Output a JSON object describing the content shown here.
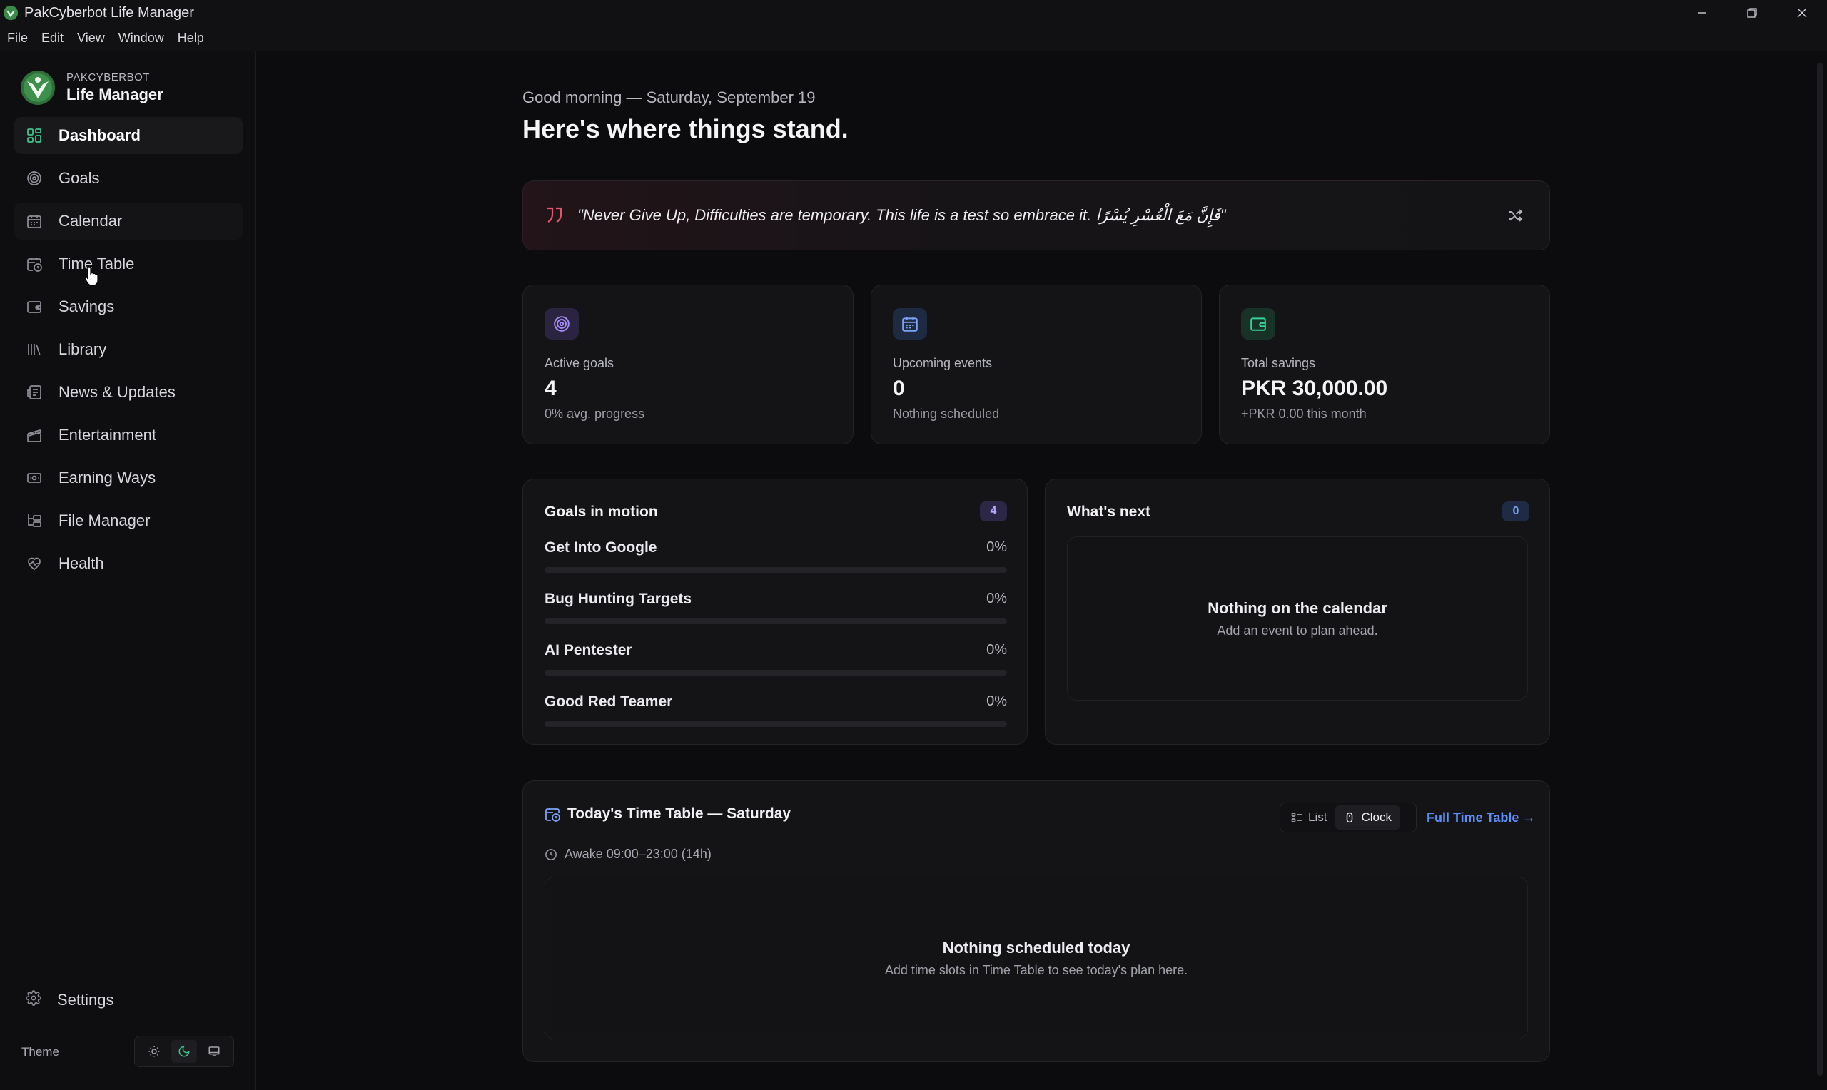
{
  "window": {
    "title": "PakCyberbot Life Manager"
  },
  "menu": [
    "File",
    "Edit",
    "View",
    "Window",
    "Help"
  ],
  "brand": {
    "small": "PAKCYBERBOT",
    "big": "Life Manager"
  },
  "sidebar": {
    "items": [
      {
        "label": "Dashboard",
        "icon": "grid-icon",
        "active": true
      },
      {
        "label": "Goals",
        "icon": "target-icon"
      },
      {
        "label": "Calendar",
        "icon": "calendar-icon",
        "hover": true
      },
      {
        "label": "Time Table",
        "icon": "calendar-clock-icon"
      },
      {
        "label": "Savings",
        "icon": "wallet-icon"
      },
      {
        "label": "Library",
        "icon": "library-icon"
      },
      {
        "label": "News & Updates",
        "icon": "newspaper-icon"
      },
      {
        "label": "Entertainment",
        "icon": "clapperboard-icon"
      },
      {
        "label": "Earning Ways",
        "icon": "banknote-icon"
      },
      {
        "label": "File Manager",
        "icon": "folder-tree-icon"
      },
      {
        "label": "Health",
        "icon": "heart-pulse-icon"
      }
    ],
    "settings_label": "Settings",
    "theme_label": "Theme",
    "theme_selected": "dark"
  },
  "main": {
    "greeting": "Good morning — Saturday, September 19",
    "headline": "Here's where things stand.",
    "quote": "\"Never Give Up, Difficulties are temporary. This life is a test so embrace it. فَإِنَّ مَعَ الْعُسْرِ يُسْرًا\""
  },
  "stats": [
    {
      "label": "Active goals",
      "value": "4",
      "sub": "0% avg. progress",
      "icon": "target-icon",
      "accent": "#a78bfa"
    },
    {
      "label": "Upcoming events",
      "value": "0",
      "sub": "Nothing scheduled",
      "icon": "calendar-icon",
      "accent": "#7aa2f7"
    },
    {
      "label": "Total savings",
      "value": "PKR 30,000.00",
      "sub": "+PKR 0.00 this month",
      "icon": "wallet-icon",
      "accent": "#34d399"
    }
  ],
  "goals_panel": {
    "title": "Goals in motion",
    "count": "4",
    "goals": [
      {
        "name": "Get Into Google",
        "pct_label": "0%",
        "progress": 0
      },
      {
        "name": "Bug Hunting Targets",
        "pct_label": "0%",
        "progress": 0
      },
      {
        "name": "AI Pentester",
        "pct_label": "0%",
        "progress": 0
      },
      {
        "name": "Good Red Teamer",
        "pct_label": "0%",
        "progress": 0
      }
    ]
  },
  "next_panel": {
    "title": "What's next",
    "count": "0",
    "empty_title": "Nothing on the calendar",
    "empty_sub": "Add an event to plan ahead."
  },
  "timetable": {
    "title": "Today's Time Table — Saturday",
    "view_list": "List",
    "view_clock": "Clock",
    "view_selected": "Clock",
    "full_link": "Full Time Table →",
    "awake": "Awake 09:00–23:00 (14h)",
    "empty_title": "Nothing scheduled today",
    "empty_sub": "Add time slots in Time Table to see today's plan here."
  },
  "colors": {
    "accent_purple": "#7a6cf0",
    "link_blue": "#5b8ff7",
    "quote_red": "#e0566f"
  }
}
